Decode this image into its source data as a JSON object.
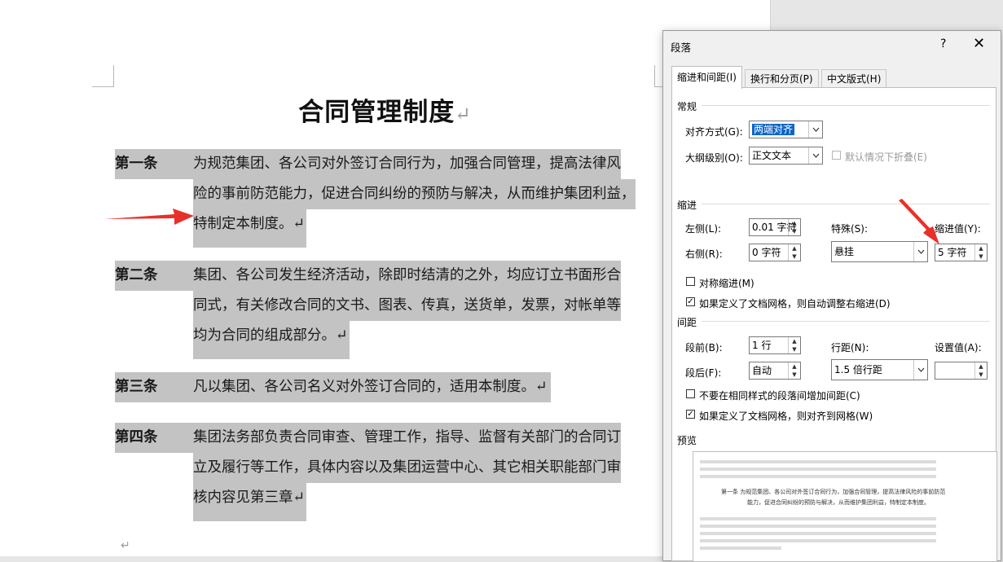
{
  "document": {
    "title": "合同管理制度",
    "paragraph_mark": "↵",
    "articles": [
      {
        "label": "第一条",
        "lines": [
          "为规范集团、各公司对外签订合同行为，加强合同管理，提高法律风",
          "险的事前防范能力，促进合同纠纷的预防与解决，从而维护集团利益，",
          "特制定本制度。↵"
        ]
      },
      {
        "label": "第二条",
        "lines": [
          "集团、各公司发生经济活动，除即时结清的之外，均应订立书面形合",
          "同式，有关修改合同的文书、图表、传真，送货单，发票，对帐单等",
          "均为合同的组成部分。↵"
        ]
      },
      {
        "label": "第三条",
        "lines": [
          "凡以集团、各公司名义对外签订合同的，适用本制度。↵"
        ]
      },
      {
        "label": "第四条",
        "lines": [
          "集团法务部负责合同审查、管理工作，指导、监督有关部门的合同订",
          "立及履行等工作，具体内容以及集团运营中心、其它相关职能部门审",
          "核内容见第三章↵"
        ]
      }
    ]
  },
  "dialog": {
    "title": "段落",
    "help": "?",
    "close": "✕",
    "tabs": [
      "缩进和间距(I)",
      "换行和分页(P)",
      "中文版式(H)"
    ],
    "general": {
      "section": "常规",
      "align_label": "对齐方式(G):",
      "align_value": "两端对齐",
      "outline_label": "大纲级别(O):",
      "outline_value": "正文文本",
      "collapse_label": "默认情况下折叠(E)"
    },
    "indent": {
      "section": "缩进",
      "left_label": "左侧(L):",
      "left_value": "0.01 字符",
      "right_label": "右侧(R):",
      "right_value": "0 字符",
      "special_label": "特殊(S):",
      "special_value": "悬挂",
      "by_label": "缩进值(Y):",
      "by_value": "5 字符",
      "mirror_label": "对称缩进(M)",
      "auto_adjust_label": "如果定义了文档网格，则自动调整右缩进(D)"
    },
    "spacing": {
      "section": "间距",
      "before_label": "段前(B):",
      "before_value": "1 行",
      "after_label": "段后(F):",
      "after_value": "自动",
      "line_label": "行距(N):",
      "line_value": "1.5 倍行距",
      "at_label": "设置值(A):",
      "at_value": "",
      "no_space_label": "不要在相同样式的段落间增加间距(C)",
      "snap_grid_label": "如果定义了文档网格，则对齐到网格(W)"
    },
    "preview": {
      "section": "预览",
      "sample_line1": "第一条      为规范集团、各公司对外签订合同行为，加强合同管理，提高法律风险的事前防范",
      "sample_line2": "能力，促进合同纠纷的预防与解决，从而维护集团利益，特制定本制度。"
    }
  },
  "colors": {
    "highlight": "#c3c3c3",
    "arrow": "#e8302a",
    "selection": "#0a64c8"
  }
}
